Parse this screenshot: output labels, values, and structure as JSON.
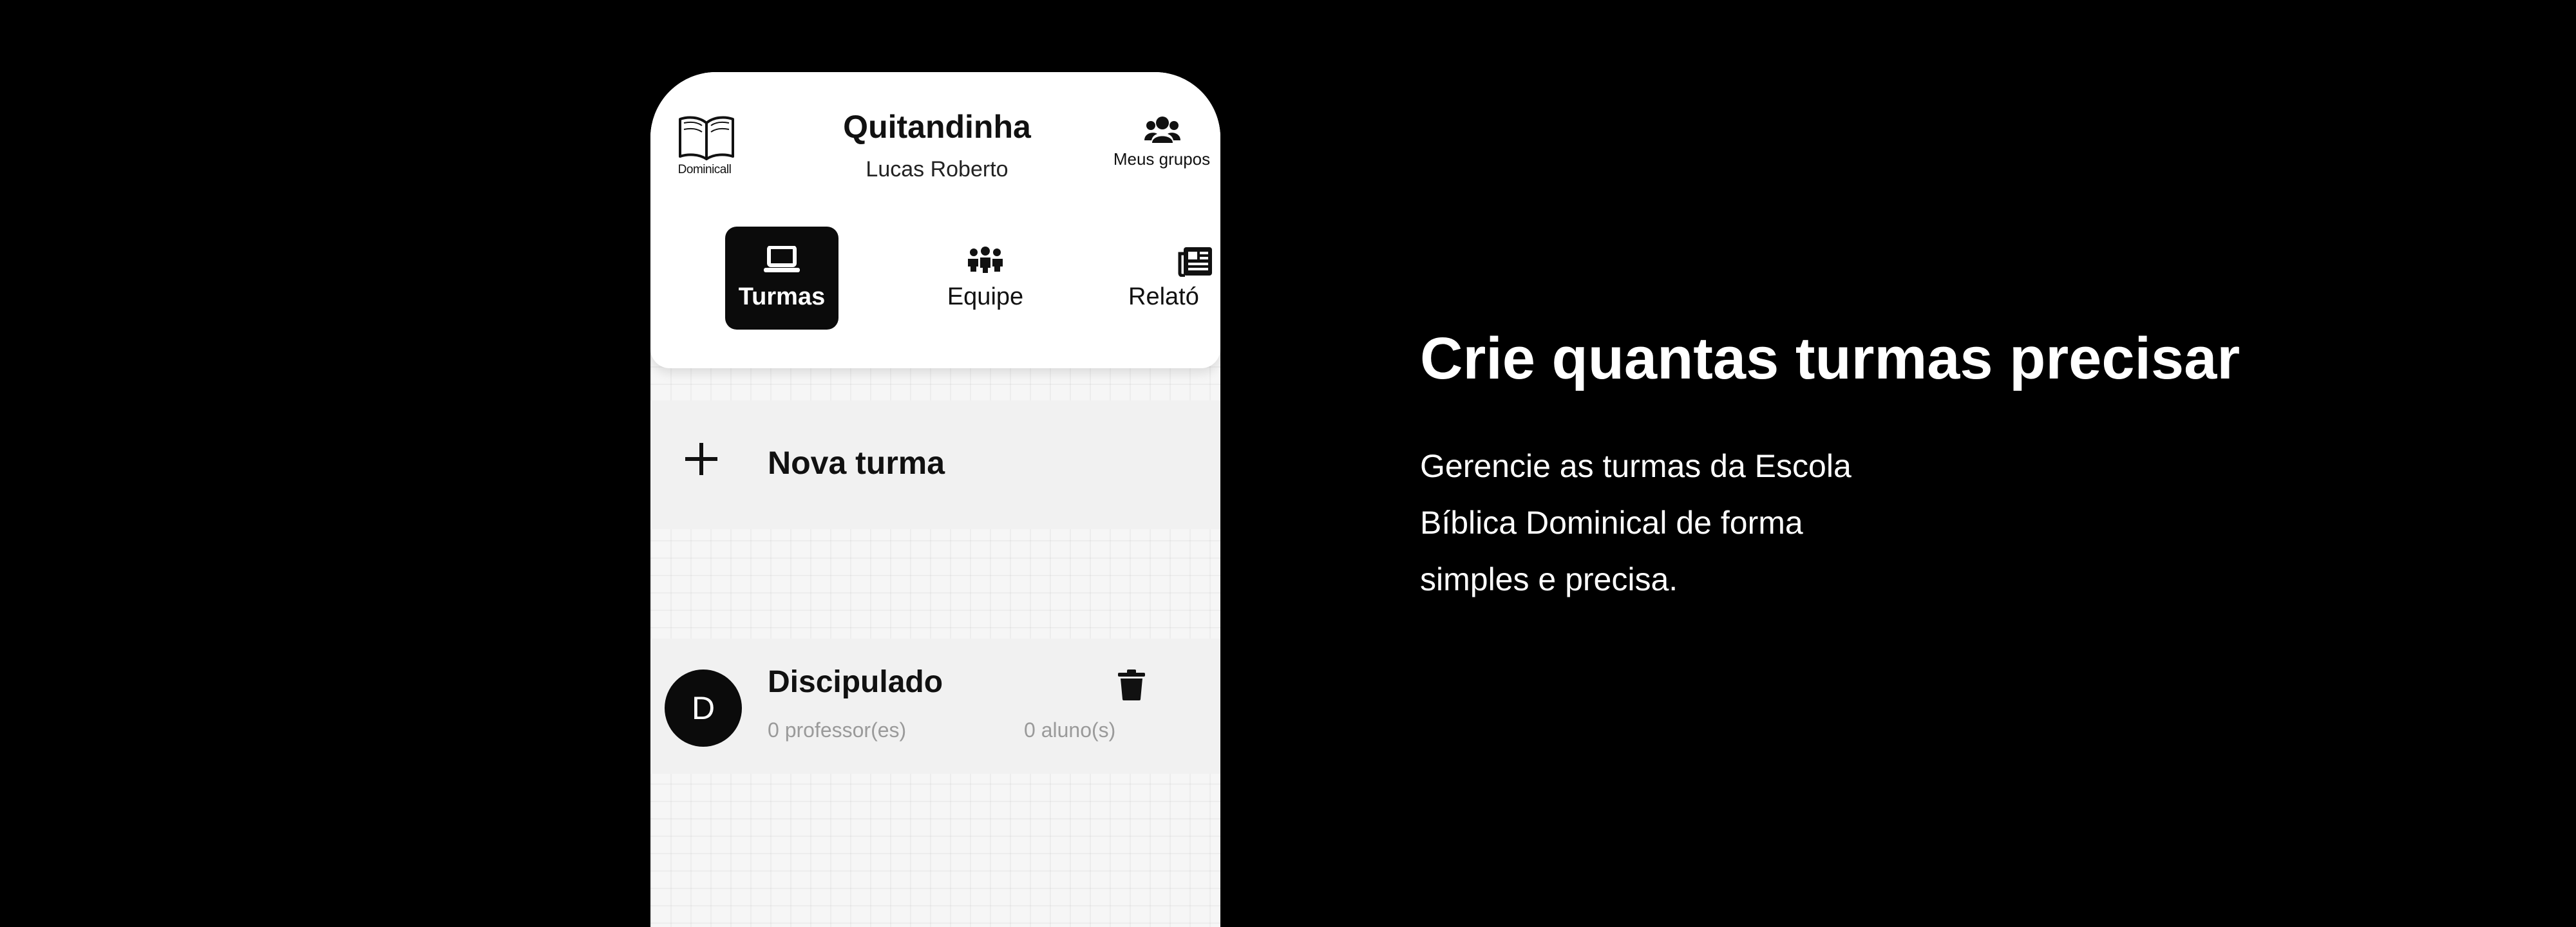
{
  "app": {
    "logo_caption": "Dominicall",
    "group_name": "Quitandinha",
    "user_name": "Lucas Roberto",
    "groups_button_label": "Meus grupos"
  },
  "tabs": [
    {
      "label": "Turmas",
      "icon": "laptop-icon",
      "active": true
    },
    {
      "label": "Equipe",
      "icon": "team-icon",
      "active": false
    },
    {
      "label": "Relató",
      "icon": "newspaper-icon",
      "active": false
    }
  ],
  "actions": {
    "new_class_label": "Nova turma"
  },
  "classes": [
    {
      "initial": "D",
      "name": "Discipulado",
      "teachers": "0 professor(es)",
      "students": "0 aluno(s)"
    }
  ],
  "hero": {
    "title": "Crie quantas turmas precisar",
    "body_lines": [
      "Gerencie as turmas da Escola",
      "Bíblica Dominical de forma",
      "simples e precisa."
    ]
  },
  "colors": {
    "background": "#000000",
    "surface": "#ffffff",
    "accent": "#0b0b0b",
    "muted_text": "#9a9a9a"
  }
}
